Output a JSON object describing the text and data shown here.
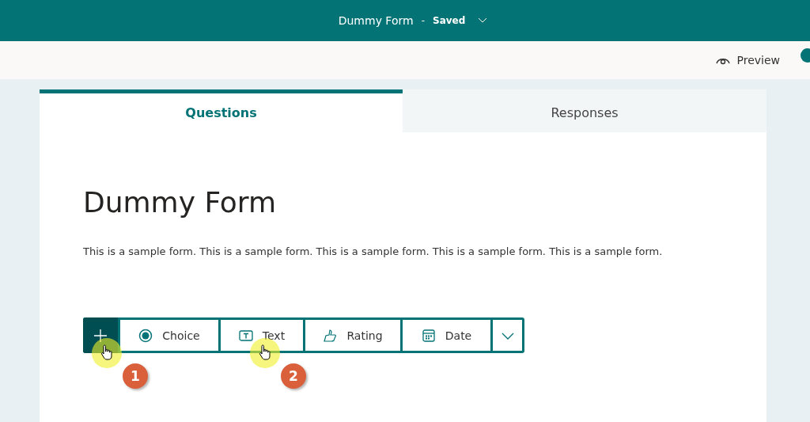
{
  "header": {
    "title": "Dummy Form",
    "separator": "-",
    "status": "Saved"
  },
  "command_bar": {
    "preview": "Preview"
  },
  "tabs": [
    {
      "label": "Questions",
      "selected": true
    },
    {
      "label": "Responses",
      "selected": false
    }
  ],
  "form": {
    "title": "Dummy Form",
    "description": "This is a sample form. This is a sample form. This is a sample form. This is a sample form. This is a sample form."
  },
  "toolbar": [
    {
      "kind": "add",
      "step": "1"
    },
    {
      "kind": "choice",
      "label": "Choice"
    },
    {
      "kind": "text",
      "label": "Text",
      "step": "2"
    },
    {
      "kind": "rating",
      "label": "Rating"
    },
    {
      "kind": "date",
      "label": "Date"
    },
    {
      "kind": "more"
    }
  ]
}
